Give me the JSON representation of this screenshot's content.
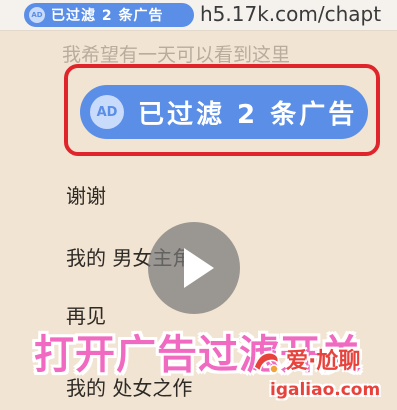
{
  "browser": {
    "url": "h5.17k.com/chapt"
  },
  "ad_filter": {
    "icon_label": "AD",
    "badge_text": "已过滤 2 条广告"
  },
  "faded_line": "我希望有一天可以看到这里",
  "chapters": [
    {
      "label": "谢谢"
    },
    {
      "label": "我的 男女主角"
    },
    {
      "label": "再见"
    },
    {
      "label": "我的 处女之作"
    }
  ],
  "caption": "打开广告过滤开关",
  "watermark": {
    "title": "爱·尬聊",
    "url": "igaliao.com"
  },
  "colors": {
    "badge_blue": "#5b8ee6",
    "highlight_red": "#e0242c",
    "caption_pink": "#f06ac2",
    "page_bg": "#f1e4d2"
  }
}
